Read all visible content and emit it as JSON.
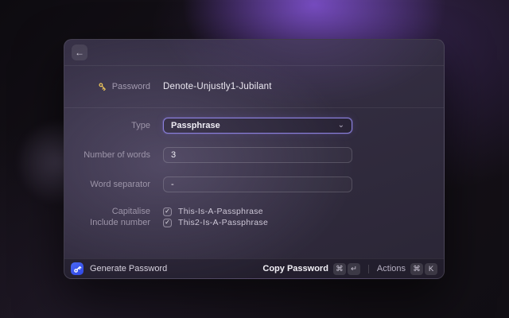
{
  "glyphs": {
    "back": "←",
    "chevron_down": "⌄",
    "check": "✓"
  },
  "colors": {
    "accent_focus": "#8b80dd",
    "key_gold": "#e9c35a",
    "badge_blue": "#3d56ee",
    "background_glow_purple": "#8a58e2"
  },
  "window": {
    "summary": {
      "icon": "key-icon",
      "label": "Password",
      "value": "Denote-Unjustly1-Jubilant"
    },
    "form": {
      "type": {
        "label": "Type",
        "value": "Passphrase",
        "control": "dropdown"
      },
      "number_of_words": {
        "label": "Number of words",
        "value": "3"
      },
      "word_separator": {
        "label": "Word separator",
        "value": "-"
      },
      "capitalise": {
        "label": "Capitalise",
        "checked": true,
        "text": "This-Is-A-Passphrase"
      },
      "include_number": {
        "label": "Include number",
        "checked": true,
        "text": "This2-Is-A-Passphrase"
      }
    },
    "footer": {
      "app": {
        "icon": "key-badge-icon",
        "label": "Generate Password"
      },
      "primary_action": {
        "label": "Copy Password",
        "keys": [
          "⌘",
          "↵"
        ]
      },
      "secondary_action": {
        "label": "Actions",
        "keys": [
          "⌘",
          "K"
        ]
      }
    }
  }
}
